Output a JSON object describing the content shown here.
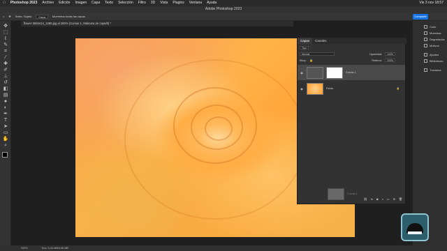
{
  "menubar": {
    "app": "Photoshop 2023",
    "items": [
      "Archivo",
      "Edición",
      "Imagen",
      "Capa",
      "Texto",
      "Selección",
      "Filtro",
      "3D",
      "Vista",
      "Plugins",
      "Ventana",
      "Ayuda"
    ],
    "clock": "Vie 3 nov 18:57"
  },
  "window": {
    "title": "Adobe Photoshop 2023"
  },
  "options": {
    "feather": "Selec. Sujeto",
    "mode": "Capa",
    "sample": "Muestrear todas las capas",
    "share": "Compartir"
  },
  "document": {
    "tab": "flower-3063414_1280.jpg al 200% (Curvas 1, Máscara de capa/8) *"
  },
  "layers_panel": {
    "tabs": [
      "Capas",
      "Canales"
    ],
    "kind": "Tipo",
    "blend": "Normal",
    "opacity_label": "Opacidad:",
    "opacity": "100%",
    "lock_label": "Bloq.:",
    "fill_label": "Relleno:",
    "fill": "100%",
    "layers": [
      {
        "name": "Curvas 1",
        "thumb": "#ffffff",
        "selected": true
      },
      {
        "name": "Fondo",
        "thumb": "#ffad45",
        "selected": false
      }
    ],
    "ghost": "Curvas 1"
  },
  "dock": [
    "Color",
    "Muestras",
    "Degradados",
    "Motivos",
    "Ajustes",
    "Bibliotecas",
    "Trazados"
  ],
  "status": {
    "zoom": "200%",
    "doc": "Doc: 5,34 MB/4,06 MB"
  },
  "colors": {
    "accent": "#1473e6",
    "panel": "#323232"
  },
  "icons": [
    "move-icon",
    "marquee-icon",
    "lasso-icon",
    "quick-select-icon",
    "crop-icon",
    "eyedropper-icon",
    "healing-icon",
    "brush-icon",
    "stamp-icon",
    "history-brush-icon",
    "eraser-icon",
    "gradient-icon",
    "blur-icon",
    "dodge-icon",
    "pen-icon",
    "type-icon",
    "path-select-icon",
    "shape-icon",
    "hand-icon",
    "zoom-icon"
  ]
}
